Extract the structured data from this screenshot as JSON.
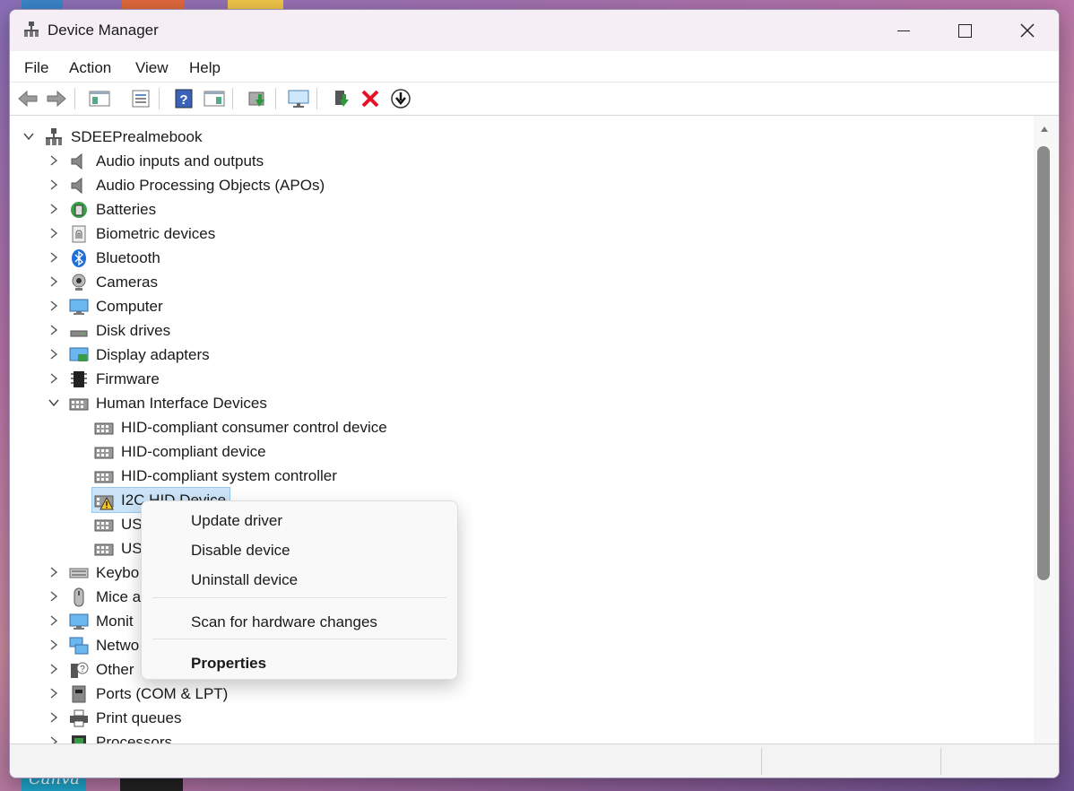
{
  "window": {
    "title": "Device Manager"
  },
  "menu": [
    "File",
    "Action",
    "View",
    "Help"
  ],
  "toolbar_icons": [
    "back-arrow-icon",
    "forward-arrow-icon",
    "show-hide-console-tree-icon",
    "properties-icon",
    "help-icon",
    "action-pane-icon",
    "update-driver-icon",
    "scan-hardware-icon",
    "add-driver-icon",
    "uninstall-x-icon",
    "download-icon"
  ],
  "tree": {
    "root": "SDEEPrealmebook",
    "categories": [
      "Audio inputs and outputs",
      "Audio Processing Objects (APOs)",
      "Batteries",
      "Biometric devices",
      "Bluetooth",
      "Cameras",
      "Computer",
      "Disk drives",
      "Display adapters",
      "Firmware",
      "Human Interface Devices"
    ],
    "hid_children": [
      "HID-compliant consumer control device",
      "HID-compliant device",
      "HID-compliant system controller",
      "I2C HID Device",
      "US",
      "US"
    ],
    "categories_after": [
      "Keybo",
      "Mice a",
      "Monit",
      "Netwo",
      "Other",
      "Ports (COM & LPT)",
      "Print queues",
      "Processors"
    ]
  },
  "context_menu": {
    "update": "Update driver",
    "disable": "Disable device",
    "uninstall": "Uninstall device",
    "scan": "Scan for hardware changes",
    "properties": "Properties"
  },
  "desktop": {
    "canva_label": "Canva"
  },
  "colors": {
    "selection": "#cce4f7",
    "accent": "#0a64c8",
    "error": "#e81123"
  }
}
